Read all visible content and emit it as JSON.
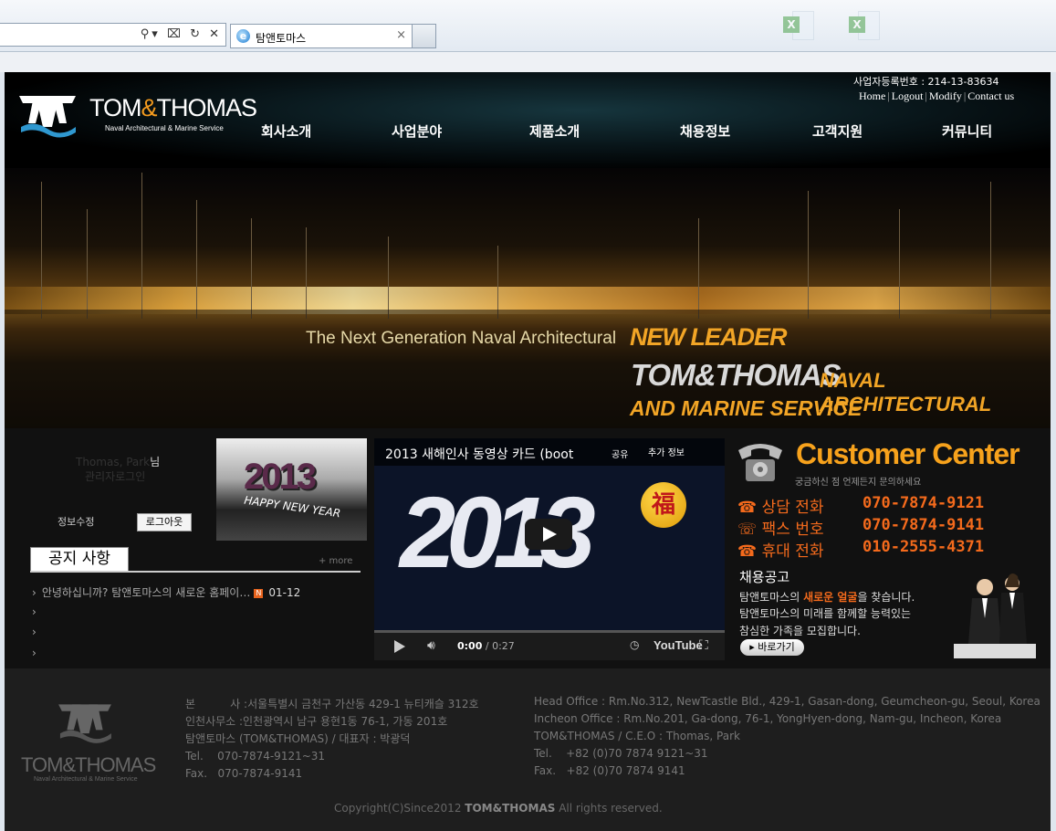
{
  "browser": {
    "tab_title": "탐앤토마스",
    "ie_glyph": "e",
    "close_glyph": "×",
    "address_icons": "⚲▾ ⌧ ↻ ✕"
  },
  "header": {
    "logo_text_1": "TOM",
    "logo_amp": "&",
    "logo_text_2": "THOMAS",
    "logo_sub": "Naval Architectural & Marine Service",
    "biz_no": "사업자등록번호 : 214-13-83634",
    "links": [
      "Home",
      "Logout",
      "Modify",
      "Contact us"
    ],
    "nav": [
      "회사소개",
      "사업분야",
      "제품소개",
      "채용정보",
      "고객지원",
      "커뮤니티"
    ]
  },
  "banner": {
    "line1": "The Next Generation Naval Architectural",
    "line2": "NEW LEADER",
    "line3": "TOM&THOMAS",
    "line4": "NAVAL ARCHITECTURAL",
    "line5": "AND MARINE SERVICE"
  },
  "login": {
    "name": "Thomas, Park",
    "suffix": "님",
    "role": "관리자로그인",
    "edit_label": "정보수정",
    "logout_label": "로그아웃"
  },
  "promo": {
    "year": "2013",
    "text": "HAPPY NEW YEAR"
  },
  "notice": {
    "title": "공지 사항",
    "more": "+ more",
    "items": [
      {
        "text": "안녕하십니까? 탐앤토마스의 새로운 홈페이…",
        "badge": "N",
        "date": "01-12"
      },
      {
        "text": "",
        "badge": "",
        "date": ""
      },
      {
        "text": "",
        "badge": "",
        "date": ""
      },
      {
        "text": "",
        "badge": "",
        "date": ""
      }
    ]
  },
  "video": {
    "title": "2013 새해인사 동영상 카드 (boot",
    "share": "공유",
    "more_info": "추가 정보",
    "big_text": "2013",
    "fu": "福",
    "time_current": "0:00",
    "time_total": "/ 0:27",
    "youtube": "YouTube"
  },
  "customer_center": {
    "title": "Customer Center",
    "subtitle": "궁금하신 점 언제든지 문의하세요",
    "rows": [
      {
        "icon": "☎",
        "label": "상담 전화",
        "number": "070-7874-9121"
      },
      {
        "icon": "☏",
        "label": "팩스 번호",
        "number": "070-7874-9141"
      },
      {
        "icon": "☎",
        "label": "휴대 전화",
        "number": "010-2555-4371"
      }
    ],
    "jobs_title": "채용공고",
    "jobs_line1_pre": "탐앤토마스의 ",
    "jobs_line1_hl": "새로운 얼굴",
    "jobs_line1_post": "을 찾습니다.",
    "jobs_line2": "탐앤토마스의 미래를 함께할 능력있는",
    "jobs_line3": "참심한 가족을 모집합니다.",
    "go_button": "▸ 바로가기"
  },
  "footer": {
    "logo_text": "TOM&THOMAS",
    "logo_sub": "Naval Architectural & Marine Service",
    "kr": [
      "본          사 :서울특별시 금천구 가산동 429-1 뉴티캐슬 312호",
      "인천사무소 :인천광역시 남구 용현1동 76-1, 가동 201호",
      "탐앤토마스 (TOM&THOMAS) / 대표자 : 박광덕",
      "Tel.    070-7874-9121~31",
      "Fax.   070-7874-9141"
    ],
    "en": [
      "Head Office : Rm.No.312, NewTcastle Bld., 429-1, Gasan-dong, Geumcheon-gu, Seoul, Korea",
      "Incheon Office : Rm.No.201, Ga-dong, 76-1, YongHyen-dong, Nam-gu, Incheon, Korea",
      "TOM&THOMAS / C.E.O : Thomas, Park",
      "Tel.    +82 (0)70 7874 9121~31",
      "Fax.   +82 (0)70 7874 9141"
    ],
    "copyright_pre": "Copyright(C)Since2012 ",
    "copyright_brand": "TOM&THOMAS",
    "copyright_post": " All rights reserved."
  }
}
